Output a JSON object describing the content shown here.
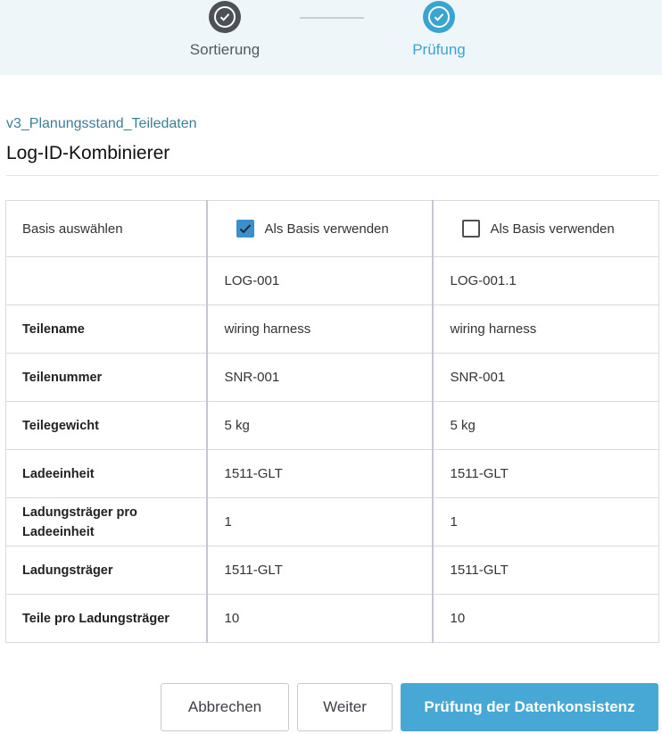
{
  "stepper": {
    "steps": [
      {
        "label": "Sortierung",
        "state": "done"
      },
      {
        "label": "Prüfung",
        "state": "active"
      }
    ]
  },
  "breadcrumb": "v3_Planungsstand_Teiledaten",
  "title": "Log-ID-Kombinierer",
  "table": {
    "basis_row_label": "Basis auswählen",
    "columns": [
      {
        "basis_label": "Als Basis verwenden",
        "checked": true,
        "log_id": "LOG-001"
      },
      {
        "basis_label": "Als Basis verwenden",
        "checked": false,
        "log_id": "LOG-001.1"
      }
    ],
    "rows": [
      {
        "label": "Teilename",
        "values": [
          "wiring harness",
          "wiring harness"
        ]
      },
      {
        "label": "Teilenummer",
        "values": [
          "SNR-001",
          "SNR-001"
        ]
      },
      {
        "label": "Teilegewicht",
        "values": [
          "5 kg",
          "5 kg"
        ]
      },
      {
        "label": "Ladeeinheit",
        "values": [
          "1511-GLT",
          "1511-GLT"
        ]
      },
      {
        "label": "Ladungsträger pro Ladeeinheit",
        "values": [
          "1",
          "1"
        ]
      },
      {
        "label": "Ladungsträger",
        "values": [
          "1511-GLT",
          "1511-GLT"
        ]
      },
      {
        "label": "Teile pro Ladungsträger",
        "values": [
          "10",
          "10"
        ]
      }
    ]
  },
  "buttons": {
    "cancel": "Abbrechen",
    "next": "Weiter",
    "check": "Prüfung der Datenkonsistenz"
  },
  "colors": {
    "accent": "#3aa4d1",
    "primary_button": "#48a8d5",
    "step_done": "#4c5157",
    "stepper_bg": "#eef6fa"
  },
  "icons": {
    "step_done": "check-circle-icon",
    "step_active": "check-circle-icon",
    "checkbox_checked": "checkmark-icon"
  }
}
